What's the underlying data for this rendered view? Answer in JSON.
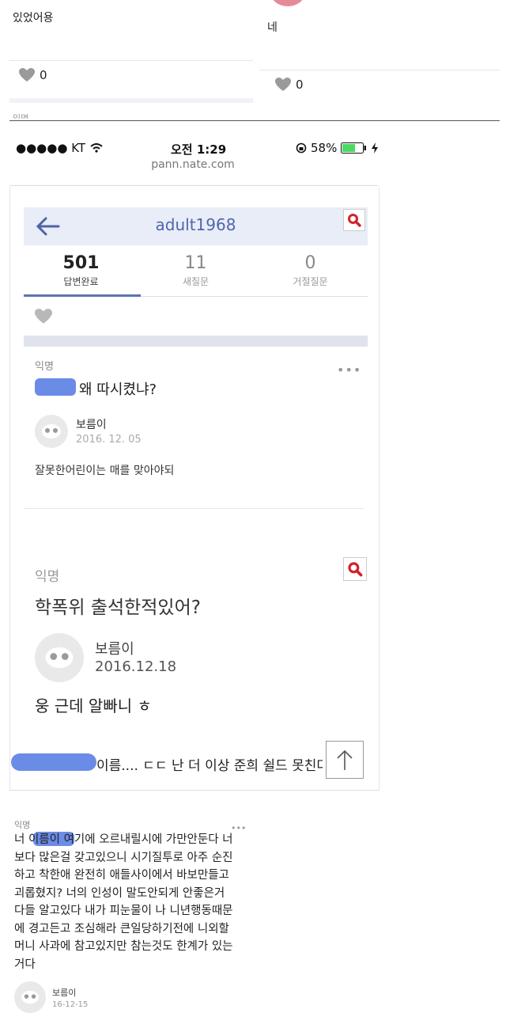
{
  "top_left": {
    "text": "있었어용",
    "likes": "0",
    "cutoff_label": "익명"
  },
  "top_right": {
    "text": "네",
    "likes": "0"
  },
  "status_bar": {
    "carrier": "●●●●● KT",
    "time": "오전 1:29",
    "battery": "58%"
  },
  "url": "pann.nate.com",
  "profile": {
    "username": "adult1968",
    "tabs": [
      {
        "count": "501",
        "label": "답변완료"
      },
      {
        "count": "11",
        "label": "새질문"
      },
      {
        "count": "0",
        "label": "거절질문"
      }
    ]
  },
  "questions": [
    {
      "asker": "익명",
      "question": "왜 따시켰냐?",
      "answerer": "보름이",
      "date": "2016. 12. 05",
      "answer": "잘못한어린이는 매를 맞아야되"
    },
    {
      "asker": "익명",
      "question": "학폭위 출석한적있어?",
      "answerer": "보름이",
      "date": "2016.12.18",
      "answer": "웅 근데 알빠니 ㅎ"
    }
  ],
  "caption": "이름.... ㄷㄷ 난 더 이상 준희 쉴드 못친다 ㅂ",
  "bottom": {
    "asker": "익명",
    "message": "너 이름이 여기에 오르내릴시에 가만안둔다 너보다 많은걸 갖고있으니 시기질투로 아주 순진하고 착한애 완전히 애들사이에서 바보만들고 괴롭혔지? 너의 인성이 말도안되게 안좋은거 다들 알고있다 내가 피눈물이 나 니년행동때문에 경고든고 조심해라 큰일당하기전에 니외할머니 사과에 참고있지만 참는것도 한계가 있는거다",
    "answerer": "보름이",
    "date": "16-12-15"
  },
  "colors": {
    "accent": "#5d73b3",
    "search_red": "#d2222d",
    "redaction": "#6b8ce6"
  }
}
